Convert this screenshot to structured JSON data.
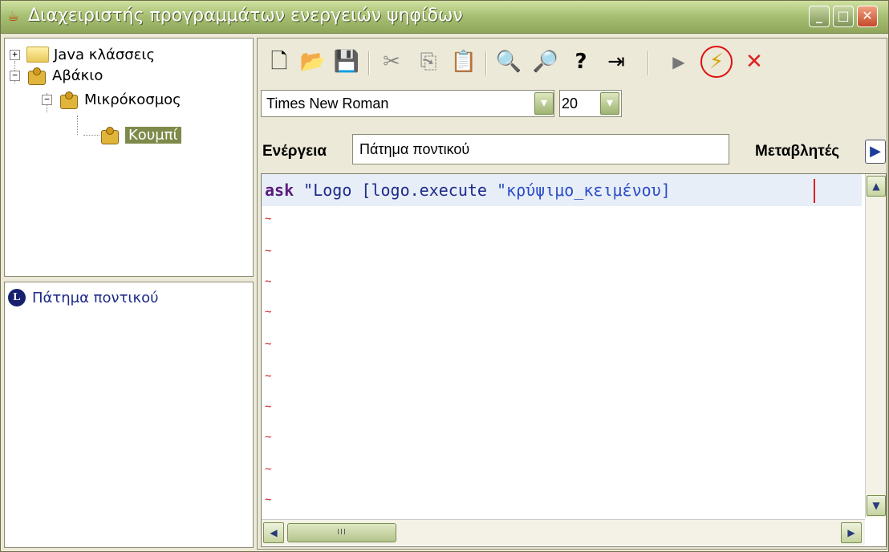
{
  "window": {
    "title": "Διαχειριστής προγραμμάτων ενεργειών ψηφίδων",
    "buttons": {
      "minimize": "_",
      "maximize": "□",
      "close": "✕"
    }
  },
  "tree": {
    "items": [
      {
        "label": "Java κλάσσεις",
        "icon": "folder-icon",
        "expander": "+"
      },
      {
        "label": "Αβάκιο",
        "icon": "puzzle-icon",
        "expander": "−"
      },
      {
        "label": "Μικρόκοσμος",
        "icon": "puzzle-icon",
        "expander": "−"
      },
      {
        "label": "Κουμπί",
        "icon": "puzzle-icon",
        "selected": true
      }
    ]
  },
  "events": {
    "items": [
      {
        "badge": "L",
        "label": "Πάτημα ποντικού"
      }
    ]
  },
  "toolbar": {
    "icons": [
      "new-file-icon",
      "open-folder-icon",
      "save-icon",
      "cut-icon",
      "copy-icon",
      "paste-icon",
      "find-icon",
      "find-next-icon",
      "replace-icon",
      "insert-icon",
      "run-icon",
      "lightning-icon",
      "delete-icon"
    ],
    "glyphs": {
      "new": "🗋",
      "open": "📂",
      "save": "💾",
      "cut": "✂",
      "copy": "⎘",
      "paste": "📋",
      "find": "🔍",
      "find_next": "🔎",
      "replace": "?",
      "insert": "⇥",
      "run": "▶",
      "lightning": "⚡",
      "delete": "✕"
    }
  },
  "font": {
    "family": "Times New Roman",
    "size": "20",
    "dropdown_glyph": "▾"
  },
  "action": {
    "label": "Ενέργεια",
    "value": "Πάτημα ποντικού",
    "variables_label": "Μεταβλητές",
    "variables_glyph": "▶"
  },
  "editor": {
    "code_keyword": "ask",
    "code_rest_1": " \"Logo [logo.execute ",
    "code_string": "\"κρύψιμο_κειμένου]",
    "empty_line_marker": "~",
    "scroll_up": "▲",
    "scroll_down": "▼",
    "scroll_left": "◀",
    "scroll_right": "▶",
    "thumb_grip": "III"
  },
  "colors": {
    "titlebar": "#a9c175",
    "keyword": "#5a1c7e",
    "text": "#1d2b8a",
    "marker": "#cc2222",
    "selection": "#7d8a4a",
    "lightning_highlight_circle": "#dd1111"
  }
}
